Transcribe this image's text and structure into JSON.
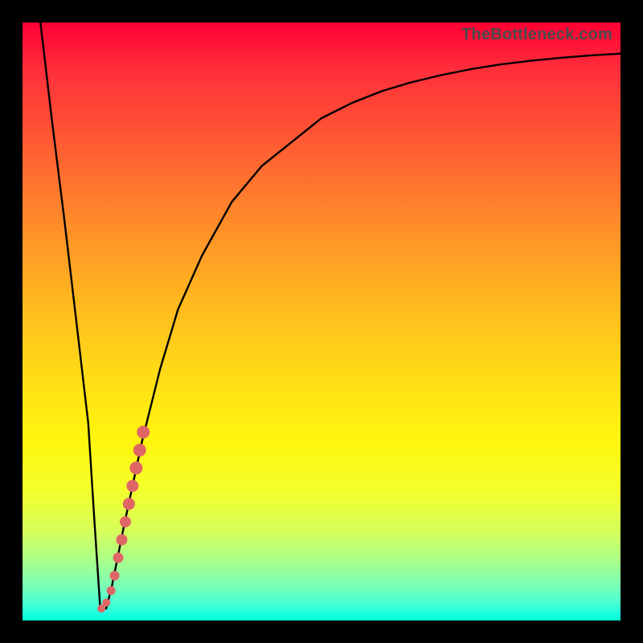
{
  "watermark": "TheBottleneck.com",
  "colors": {
    "frame": "#000000",
    "curve_stroke": "#000000",
    "dot_fill": "#e06666",
    "gradient_stops": [
      "#ff0034",
      "#ff2f3a",
      "#ff5a33",
      "#ff8a2a",
      "#ffb61f",
      "#ffdc16",
      "#fff60e",
      "#f4ff2a",
      "#d6ff5a",
      "#a9ff8a",
      "#7dffb4",
      "#4bffd0",
      "#1affe0",
      "#00ffd0"
    ]
  },
  "chart_data": {
    "type": "line",
    "title": "",
    "xlabel": "",
    "ylabel": "",
    "xlim": [
      0,
      100
    ],
    "ylim": [
      0,
      100
    ],
    "grid": false,
    "legend": false,
    "series": [
      {
        "name": "bottleneck-curve",
        "x": [
          3,
          5,
          7,
          9,
          11,
          12,
          13,
          14,
          15,
          17,
          20,
          23,
          26,
          30,
          35,
          40,
          45,
          50,
          55,
          60,
          65,
          70,
          75,
          80,
          85,
          90,
          95,
          100
        ],
        "y": [
          100,
          83,
          67,
          50,
          33,
          17,
          2,
          2,
          6,
          16,
          30,
          42,
          52,
          61,
          70,
          76,
          80,
          84,
          86.5,
          88.5,
          90,
          91.2,
          92.2,
          93,
          93.6,
          94.1,
          94.5,
          94.8
        ]
      }
    ],
    "highlight_points": {
      "name": "highlight-dots",
      "x": [
        13.2,
        14.0,
        14.8,
        15.4,
        16.0,
        16.6,
        17.2,
        17.8,
        18.4,
        19.0,
        19.6,
        20.2
      ],
      "y": [
        2.0,
        3.0,
        5.0,
        7.5,
        10.5,
        13.5,
        16.5,
        19.5,
        22.5,
        25.5,
        28.5,
        31.5
      ],
      "r": [
        5,
        5,
        5.5,
        6,
        6.5,
        7,
        7,
        7.5,
        7.5,
        8,
        8,
        8
      ]
    }
  }
}
